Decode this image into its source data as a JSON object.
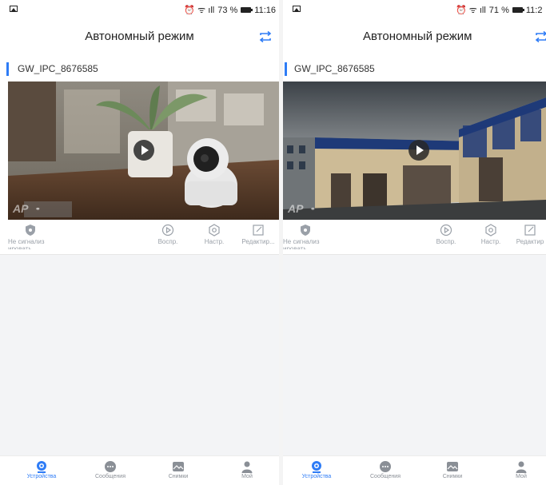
{
  "left": {
    "status_bar": {
      "indicators": "⏰ ᯤ ıll",
      "battery": "73 %",
      "time": "11:16"
    },
    "title": "Автономный режим",
    "device_name": "GW_IPC_8676585",
    "video": {
      "watermark": "AP"
    },
    "actions": {
      "alarm_status": "Не сигнализ",
      "alarm_status_cut": "ировать",
      "playback": "Воспр.",
      "settings": "Настр.",
      "edit": "Редактир..."
    },
    "tabs": [
      "Устройства",
      "Сообщения",
      "Снимки",
      "Мой"
    ]
  },
  "right": {
    "status_bar": {
      "indicators": "⏰ ᯤ ıll",
      "battery": "71 %",
      "time": "11:2"
    },
    "title": "Автономный режим",
    "device_name": "GW_IPC_8676585",
    "video": {
      "watermark": "AP"
    },
    "actions": {
      "alarm_status": "Не сигнализ",
      "alarm_status_cut": "ировать",
      "playback": "Воспр.",
      "settings": "Настр.",
      "edit": "Редактир"
    },
    "tabs": [
      "Устройства",
      "Сообщения",
      "Снимки",
      "Мой"
    ]
  },
  "colors": {
    "accent": "#2e7cf6",
    "inactive": "#9aa0a8",
    "background_grey": "#f3f4f6"
  },
  "icons": [
    "gallery-icon",
    "alarm-icon",
    "wifi-icon",
    "signal-icon",
    "battery-icon",
    "switch-mode-icon",
    "play-icon",
    "shield-icon",
    "playback-icon",
    "settings-icon",
    "edit-icon",
    "devices-icon",
    "messages-icon",
    "snapshots-icon",
    "profile-icon"
  ]
}
